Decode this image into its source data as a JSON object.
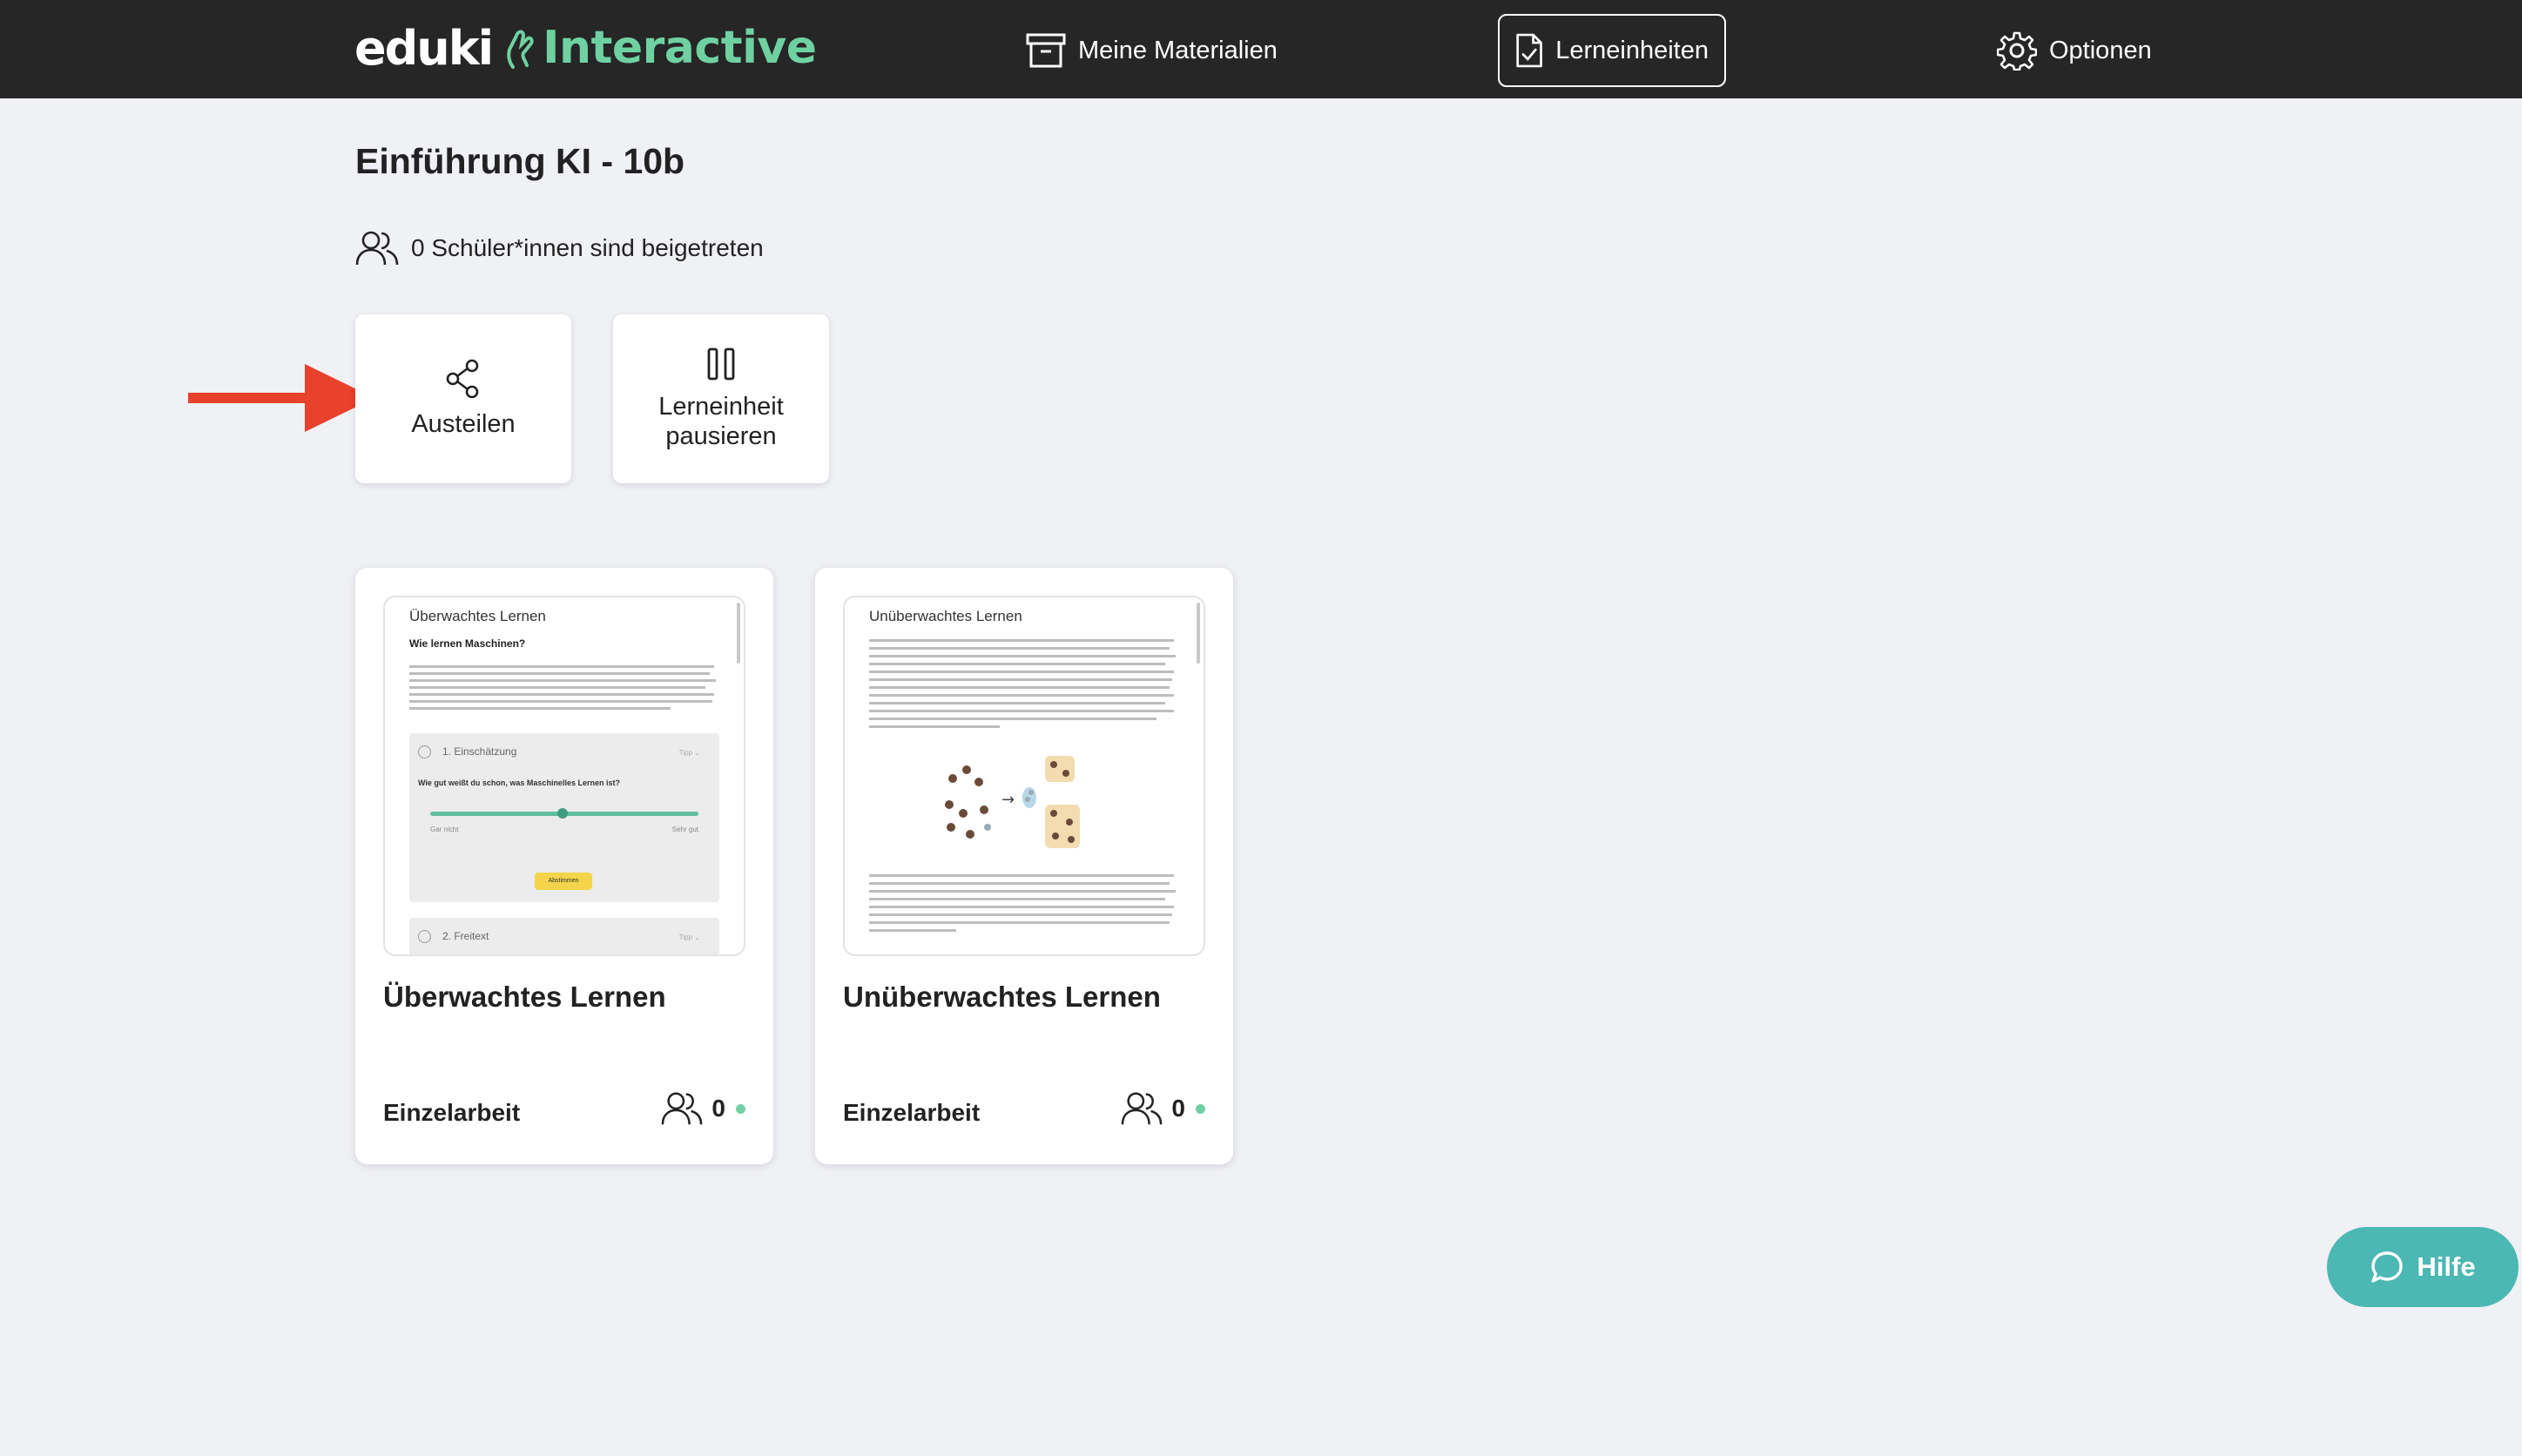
{
  "header": {
    "logo_left": "eduki",
    "logo_right": "Interactive",
    "nav": {
      "materialien": "Meine Materialien",
      "lerneinheiten": "Lerneinheiten",
      "optionen": "Optionen"
    }
  },
  "page": {
    "title": "Einführung KI - 10b",
    "students_joined": "0 Schüler*innen sind beigetreten"
  },
  "actions": {
    "share_label": "Austeilen",
    "pause_label": "Lerneinheit pausieren"
  },
  "materials": [
    {
      "title": "Überwachtes Lernen",
      "mode": "Einzelarbeit",
      "count": "0",
      "preview": {
        "title": "Überwachtes Lernen",
        "subtitle": "Wie lernen Maschinen?",
        "task1": "1. Einschätzung",
        "task1_tag": "Tipp ⌄",
        "question": "Wie gut weißt du schon, was Maschinelles Lernen ist?",
        "scale_left": "Gar nicht",
        "scale_right": "Sehr gut",
        "button": "Abstimmen",
        "task2": "2. Freitext",
        "task2_tag": "Tipp ⌄"
      }
    },
    {
      "title": "Unüberwachtes Lernen",
      "mode": "Einzelarbeit",
      "count": "0",
      "preview": {
        "title": "Unüberwachtes Lernen"
      }
    }
  ],
  "help": {
    "label": "Hilfe"
  },
  "colors": {
    "topbar": "#262626",
    "brand_green": "#6fd1a2",
    "help_button": "#4bb8b4",
    "arrow_red": "#e8412c",
    "background": "#f0f1f5"
  }
}
